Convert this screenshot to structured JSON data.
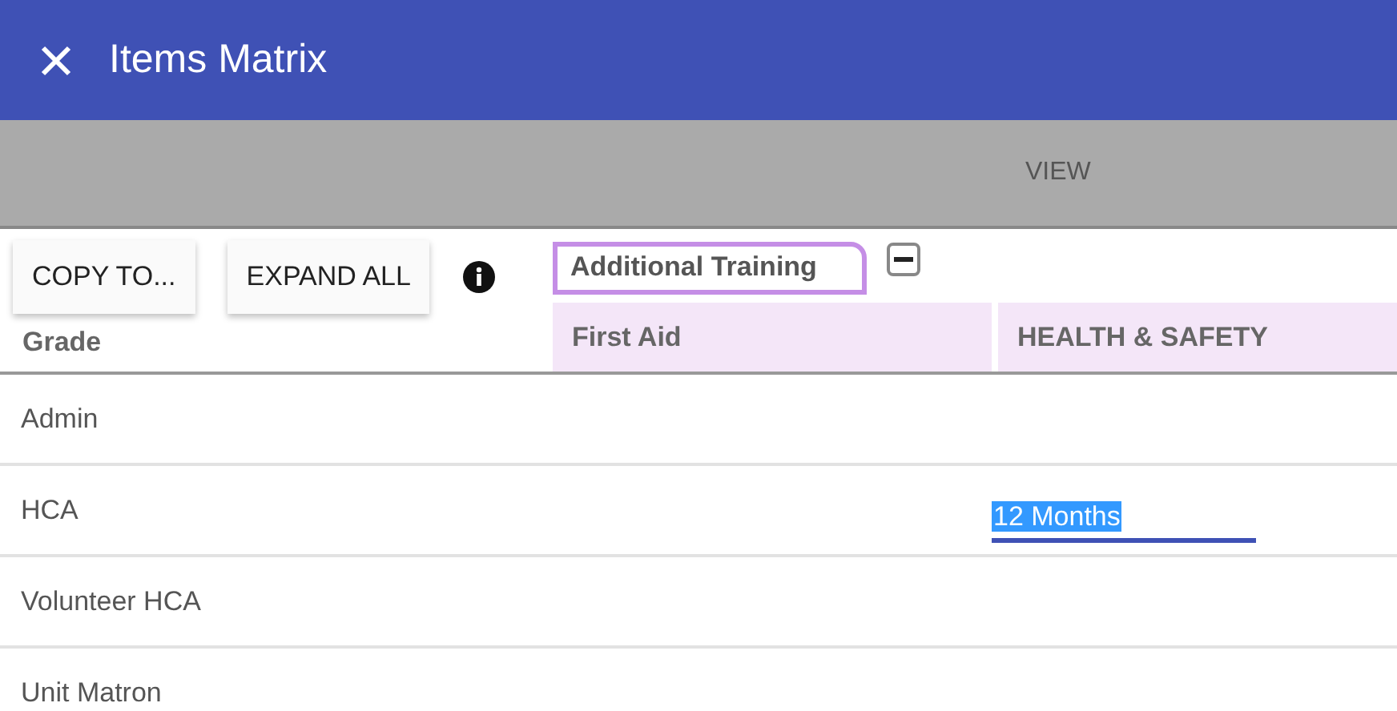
{
  "window": {
    "title": "Items Matrix"
  },
  "view_bar": {
    "label": "VIEW"
  },
  "toolbar": {
    "buttons": [
      "COPY TO...",
      "EXPAND ALL"
    ]
  },
  "group": {
    "label": "Additional Training",
    "expanded": true
  },
  "columns": [
    "Grade",
    "First Aid",
    "HEALTH & SAFETY"
  ],
  "rows": [
    {
      "grade": "Admin"
    },
    {
      "grade": "HCA",
      "health_safety": {
        "value": "12 Months",
        "editing": true
      }
    },
    {
      "grade": "Volunteer HCA"
    },
    {
      "grade": "Unit Matron"
    }
  ]
}
